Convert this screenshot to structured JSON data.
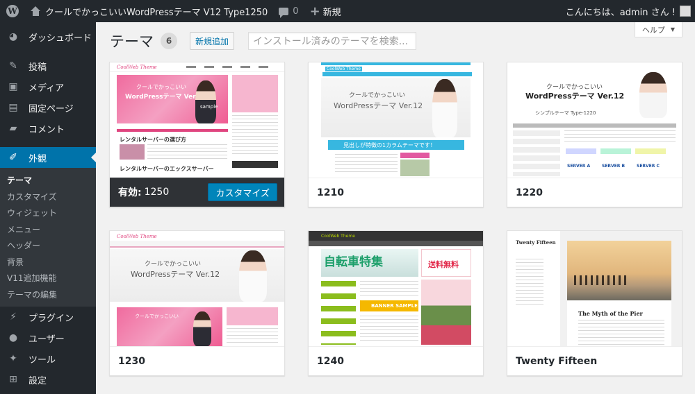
{
  "adminbar": {
    "site_title": "クールでかっこいいWordPressテーマ V12 Type1250",
    "comments_count": "0",
    "new_label": "新規",
    "greeting": "こんにちは、admin さん !"
  },
  "sidebar": {
    "items": [
      {
        "label": "ダッシュボード",
        "icon": "dashboard-icon"
      },
      {
        "label": "投稿",
        "icon": "pin-icon"
      },
      {
        "label": "メディア",
        "icon": "media-icon"
      },
      {
        "label": "固定ページ",
        "icon": "page-icon"
      },
      {
        "label": "コメント",
        "icon": "comment-icon"
      },
      {
        "label": "外観",
        "icon": "brush-icon"
      },
      {
        "label": "プラグイン",
        "icon": "plugin-icon"
      },
      {
        "label": "ユーザー",
        "icon": "user-icon"
      },
      {
        "label": "ツール",
        "icon": "wrench-icon"
      },
      {
        "label": "設定",
        "icon": "settings-icon"
      }
    ],
    "submenu": [
      "テーマ",
      "カスタマイズ",
      "ウィジェット",
      "メニュー",
      "ヘッダー",
      "背景",
      "V11追加機能",
      "テーマの編集"
    ]
  },
  "main": {
    "help_label": "ヘルプ",
    "page_title": "テーマ",
    "count": "6",
    "add_new_label": "新規追加",
    "search_placeholder": "インストール済みのテーマを検索...",
    "active_label": "有効:",
    "customize_label": "カスタマイズ",
    "themes": [
      {
        "name": "1250",
        "active": true
      },
      {
        "name": "1210",
        "active": false
      },
      {
        "name": "1220",
        "active": false
      },
      {
        "name": "1230",
        "active": false
      },
      {
        "name": "1240",
        "active": false
      },
      {
        "name": "Twenty Fifteen",
        "active": false
      }
    ]
  },
  "shots": {
    "logo": "CoolWeb Theme",
    "hero_line1": "クールでかっこいい",
    "hero_line2": "WordPressテーマ Ver.12",
    "sample": "sample",
    "t1250_post1": "レンタルサーバーの選び方",
    "t1250_post2": "レンタルサーバーのエックスサーバー",
    "t1210_bar": "見出しが特徴の1カラムテーマです！",
    "t1220_sub": "シンプルテーマ Type-1220",
    "t1220_servers": [
      "SERVER A",
      "SERVER B",
      "SERVER C"
    ],
    "t1240_hero": "自転車特集",
    "t1240_promo": "送料無料",
    "t1240_banner": "BANNER SAMPLE",
    "tf_site": "Twenty Fifteen",
    "tf_post": "The Myth of the Pier"
  },
  "colors": {
    "adminbar_bg": "#23282d",
    "active_menu": "#0073aa",
    "customize_button": "#0085ba",
    "brand_pink": "#f06b9e"
  }
}
